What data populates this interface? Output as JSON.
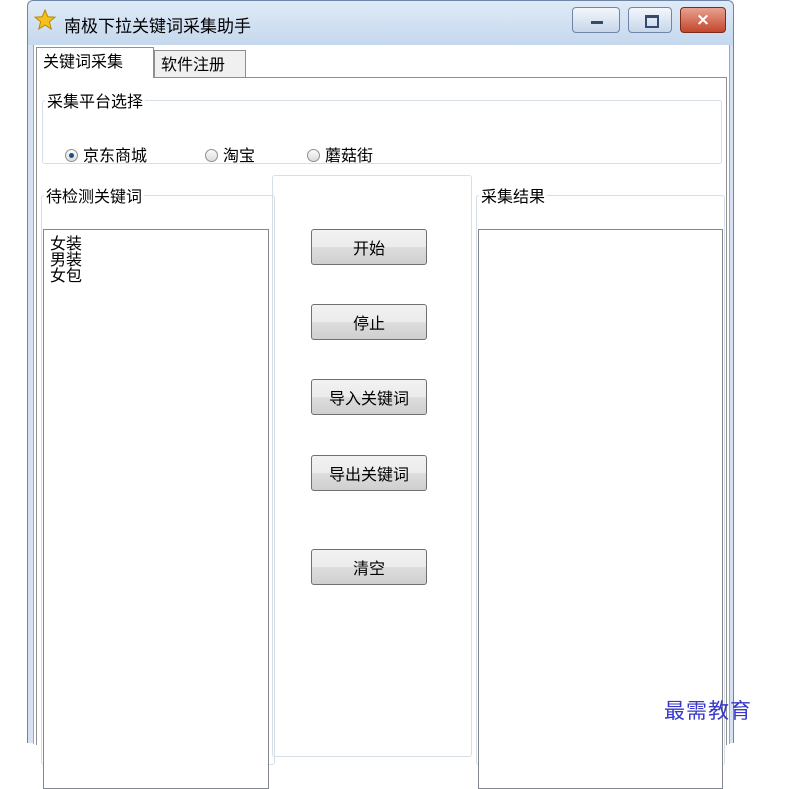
{
  "window": {
    "title": "南极下拉关键词采集助手",
    "icon": "star-icon",
    "controls": {
      "minimize": "minimize-icon",
      "maximize": "maximize-icon",
      "close": "×"
    }
  },
  "tabs": [
    {
      "label": "关键词采集",
      "active": true
    },
    {
      "label": "软件注册",
      "active": false
    }
  ],
  "platform": {
    "legend": "采集平台选择",
    "options": [
      {
        "label": "京东商城",
        "selected": true
      },
      {
        "label": "淘宝",
        "selected": false
      },
      {
        "label": "蘑菇街",
        "selected": false
      }
    ]
  },
  "pending": {
    "legend": "待检测关键词",
    "items": [
      "女装",
      "男装",
      "女包"
    ]
  },
  "buttons": {
    "start": "开始",
    "stop": "停止",
    "import": "导入关键词",
    "export": "导出关键词",
    "clear": "清空"
  },
  "results": {
    "legend": "采集结果",
    "items": []
  },
  "watermark": "最需教育",
  "colors": {
    "accent": "#214c8a",
    "close": "#c4462c",
    "watermark": "#3838c8"
  }
}
